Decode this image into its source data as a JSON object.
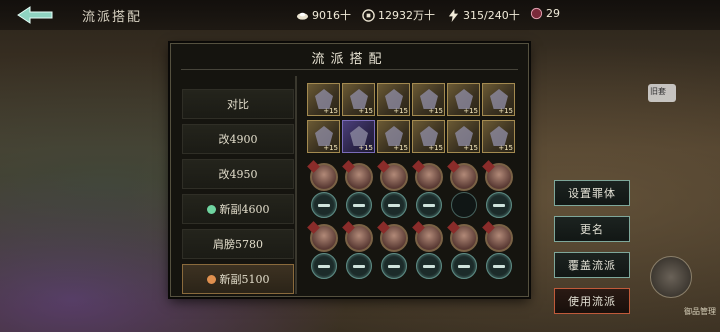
{
  "header": {
    "title": "流派搭配",
    "resources": [
      {
        "icon": "ingot-icon",
        "value": "9016十"
      },
      {
        "icon": "coin-icon",
        "value": "12932万十"
      },
      {
        "icon": "stamina-bolt-icon",
        "value": "315/240十"
      },
      {
        "icon": "sigil-icon",
        "value": "29"
      }
    ]
  },
  "panel": {
    "title": "流派搭配",
    "tabs": [
      {
        "label": "对比",
        "dot": null
      },
      {
        "label": "改4900",
        "dot": null
      },
      {
        "label": "改4950",
        "dot": null
      },
      {
        "label": "新副4600",
        "dot": "#6fd4a0"
      },
      {
        "label": "肩膀5780",
        "dot": null
      },
      {
        "label": "新副5100",
        "dot": "#e0904f",
        "active": true
      }
    ],
    "gear_levels": [
      "+15",
      "+15",
      "+15",
      "+15",
      "+15",
      "+15",
      "+15",
      "+15",
      "+15",
      "+15",
      "+15",
      "+15"
    ]
  },
  "actions": {
    "set_main": "设置罪体",
    "rename": "更名",
    "overwrite": "覆盖流派",
    "use": "使用流派"
  },
  "side": {
    "corner_label": "御品管理",
    "mini_label": "旧套"
  }
}
